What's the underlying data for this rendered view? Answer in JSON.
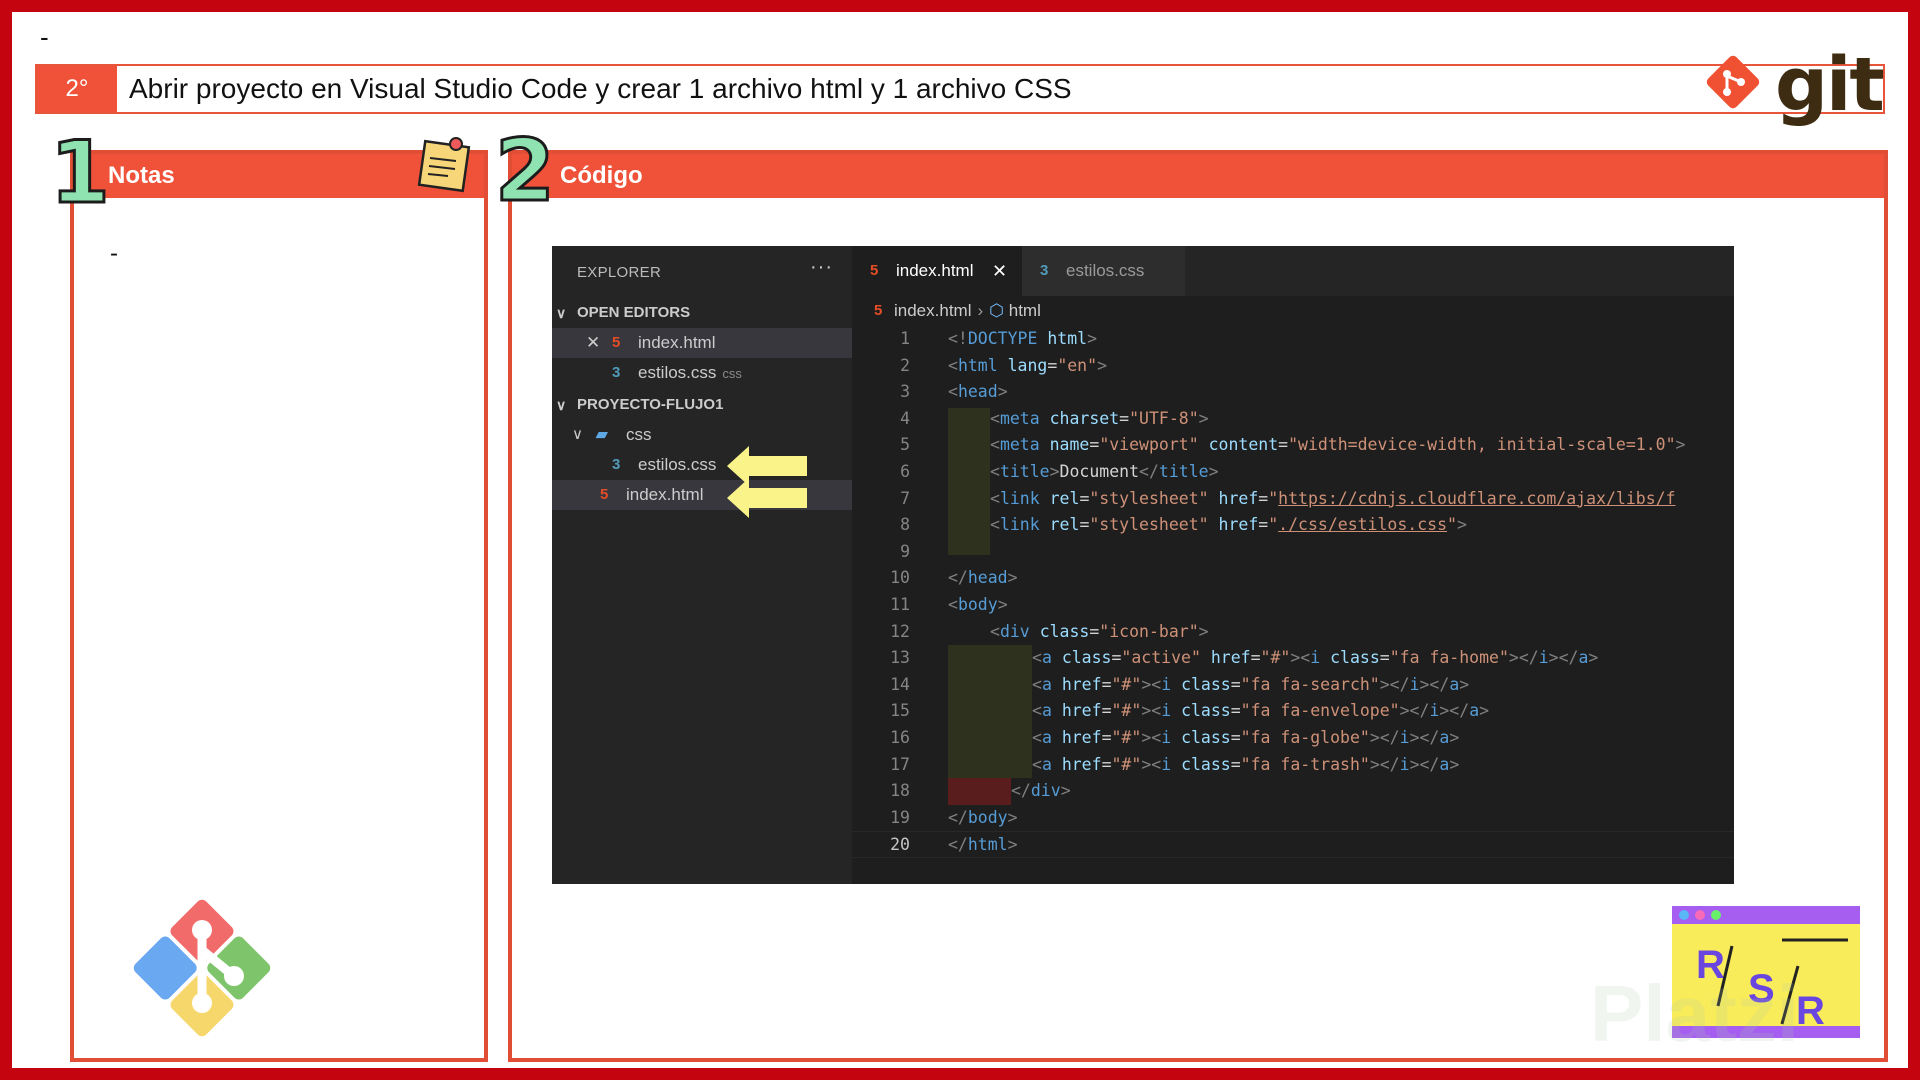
{
  "slide": {
    "top_dash": "-",
    "step": "2°",
    "title": "Abrir proyecto en Visual Studio Code y crear 1 archivo html y 1 archivo CSS",
    "git_logo_text": "git",
    "notes_number": "1",
    "notes_title": "Notas",
    "notes_content": "-",
    "code_number": "2",
    "code_title": "Código",
    "rsr_logo_text": "R/S/R",
    "watermark": "Platzi"
  },
  "vscode": {
    "explorer_title": "EXPLORER",
    "more_icon": "···",
    "open_editors": {
      "label": "OPEN EDITORS",
      "items": [
        {
          "name": "index.html",
          "icon": "html5-icon",
          "extra": ""
        },
        {
          "name": "estilos.css",
          "icon": "css3-icon",
          "extra": "css"
        }
      ]
    },
    "project": {
      "label": "PROYECTO-FLUJO1",
      "folder": "css",
      "files": [
        {
          "name": "estilos.css",
          "icon": "css3-icon"
        },
        {
          "name": "index.html",
          "icon": "html5-icon"
        }
      ]
    },
    "tabs": [
      {
        "label": "index.html",
        "active": true
      },
      {
        "label": "estilos.css",
        "active": false
      }
    ],
    "breadcrumb": {
      "file": "index.html",
      "node": "html"
    },
    "current_line": 20,
    "code_lines": [
      {
        "n": "1",
        "tokens": [
          [
            "b",
            "<!"
          ],
          [
            "t",
            "DOCTYPE"
          ],
          [
            "x",
            " "
          ],
          [
            "a",
            "html"
          ],
          [
            "b",
            ">"
          ]
        ]
      },
      {
        "n": "2",
        "tokens": [
          [
            "b",
            "<"
          ],
          [
            "t",
            "html"
          ],
          [
            "x",
            " "
          ],
          [
            "a",
            "lang"
          ],
          [
            "x",
            "="
          ],
          [
            "s",
            "\"en\""
          ],
          [
            "b",
            ">"
          ]
        ]
      },
      {
        "n": "3",
        "tokens": [
          [
            "b",
            "<"
          ],
          [
            "t",
            "head"
          ],
          [
            "b",
            ">"
          ]
        ]
      },
      {
        "n": "4",
        "indent": 1,
        "tokens": [
          [
            "b",
            "<"
          ],
          [
            "t",
            "meta"
          ],
          [
            "x",
            " "
          ],
          [
            "a",
            "charset"
          ],
          [
            "x",
            "="
          ],
          [
            "s",
            "\"UTF-8\""
          ],
          [
            "b",
            ">"
          ]
        ]
      },
      {
        "n": "5",
        "indent": 1,
        "tokens": [
          [
            "b",
            "<"
          ],
          [
            "t",
            "meta"
          ],
          [
            "x",
            " "
          ],
          [
            "a",
            "name"
          ],
          [
            "x",
            "="
          ],
          [
            "s",
            "\"viewport\""
          ],
          [
            "x",
            " "
          ],
          [
            "a",
            "content"
          ],
          [
            "x",
            "="
          ],
          [
            "s",
            "\"width=device-width, initial-scale=1.0\""
          ],
          [
            "b",
            ">"
          ]
        ]
      },
      {
        "n": "6",
        "indent": 1,
        "tokens": [
          [
            "b",
            "<"
          ],
          [
            "t",
            "title"
          ],
          [
            "b",
            ">"
          ],
          [
            "x",
            "Document"
          ],
          [
            "b",
            "</"
          ],
          [
            "t",
            "title"
          ],
          [
            "b",
            ">"
          ]
        ]
      },
      {
        "n": "7",
        "indent": 1,
        "tokens": [
          [
            "b",
            "<"
          ],
          [
            "t",
            "link"
          ],
          [
            "x",
            " "
          ],
          [
            "a",
            "rel"
          ],
          [
            "x",
            "="
          ],
          [
            "s",
            "\"stylesheet\""
          ],
          [
            "x",
            " "
          ],
          [
            "a",
            "href"
          ],
          [
            "x",
            "="
          ],
          [
            "s",
            "\""
          ],
          [
            "l",
            "https://cdnjs.cloudflare.com/ajax/libs/f"
          ]
        ]
      },
      {
        "n": "8",
        "indent": 1,
        "tokens": [
          [
            "b",
            "<"
          ],
          [
            "t",
            "link"
          ],
          [
            "x",
            " "
          ],
          [
            "a",
            "rel"
          ],
          [
            "x",
            "="
          ],
          [
            "s",
            "\"stylesheet\""
          ],
          [
            "x",
            " "
          ],
          [
            "a",
            "href"
          ],
          [
            "x",
            "="
          ],
          [
            "s",
            "\""
          ],
          [
            "l",
            "./css/estilos.css"
          ],
          [
            "s",
            "\""
          ],
          [
            "b",
            ">"
          ]
        ]
      },
      {
        "n": "9",
        "indent": 1,
        "tokens": []
      },
      {
        "n": "10",
        "tokens": [
          [
            "b",
            "</"
          ],
          [
            "t",
            "head"
          ],
          [
            "b",
            ">"
          ]
        ]
      },
      {
        "n": "11",
        "tokens": [
          [
            "b",
            "<"
          ],
          [
            "t",
            "body"
          ],
          [
            "b",
            ">"
          ]
        ]
      },
      {
        "n": "12",
        "indent": 1,
        "tokens": [
          [
            "b",
            "<"
          ],
          [
            "t",
            "div"
          ],
          [
            "x",
            " "
          ],
          [
            "a",
            "class"
          ],
          [
            "x",
            "="
          ],
          [
            "s",
            "\"icon-bar\""
          ],
          [
            "b",
            ">"
          ]
        ]
      },
      {
        "n": "13",
        "indent": 2,
        "tokens": [
          [
            "b",
            "<"
          ],
          [
            "t",
            "a"
          ],
          [
            "x",
            " "
          ],
          [
            "a",
            "class"
          ],
          [
            "x",
            "="
          ],
          [
            "s",
            "\"active\""
          ],
          [
            "x",
            " "
          ],
          [
            "a",
            "href"
          ],
          [
            "x",
            "="
          ],
          [
            "s",
            "\"#\""
          ],
          [
            "b",
            "><"
          ],
          [
            "t",
            "i"
          ],
          [
            "x",
            " "
          ],
          [
            "a",
            "class"
          ],
          [
            "x",
            "="
          ],
          [
            "s",
            "\"fa fa-home\""
          ],
          [
            "b",
            "></"
          ],
          [
            "t",
            "i"
          ],
          [
            "b",
            "></"
          ],
          [
            "t",
            "a"
          ],
          [
            "b",
            ">"
          ]
        ]
      },
      {
        "n": "14",
        "indent": 2,
        "tokens": [
          [
            "b",
            "<"
          ],
          [
            "t",
            "a"
          ],
          [
            "x",
            " "
          ],
          [
            "a",
            "href"
          ],
          [
            "x",
            "="
          ],
          [
            "s",
            "\"#\""
          ],
          [
            "b",
            "><"
          ],
          [
            "t",
            "i"
          ],
          [
            "x",
            " "
          ],
          [
            "a",
            "class"
          ],
          [
            "x",
            "="
          ],
          [
            "s",
            "\"fa fa-search\""
          ],
          [
            "b",
            "></"
          ],
          [
            "t",
            "i"
          ],
          [
            "b",
            "></"
          ],
          [
            "t",
            "a"
          ],
          [
            "b",
            ">"
          ]
        ]
      },
      {
        "n": "15",
        "indent": 2,
        "tokens": [
          [
            "b",
            "<"
          ],
          [
            "t",
            "a"
          ],
          [
            "x",
            " "
          ],
          [
            "a",
            "href"
          ],
          [
            "x",
            "="
          ],
          [
            "s",
            "\"#\""
          ],
          [
            "b",
            "><"
          ],
          [
            "t",
            "i"
          ],
          [
            "x",
            " "
          ],
          [
            "a",
            "class"
          ],
          [
            "x",
            "="
          ],
          [
            "s",
            "\"fa fa-envelope\""
          ],
          [
            "b",
            "></"
          ],
          [
            "t",
            "i"
          ],
          [
            "b",
            "></"
          ],
          [
            "t",
            "a"
          ],
          [
            "b",
            ">"
          ]
        ]
      },
      {
        "n": "16",
        "indent": 2,
        "tokens": [
          [
            "b",
            "<"
          ],
          [
            "t",
            "a"
          ],
          [
            "x",
            " "
          ],
          [
            "a",
            "href"
          ],
          [
            "x",
            "="
          ],
          [
            "s",
            "\"#\""
          ],
          [
            "b",
            "><"
          ],
          [
            "t",
            "i"
          ],
          [
            "x",
            " "
          ],
          [
            "a",
            "class"
          ],
          [
            "x",
            "="
          ],
          [
            "s",
            "\"fa fa-globe\""
          ],
          [
            "b",
            "></"
          ],
          [
            "t",
            "i"
          ],
          [
            "b",
            "></"
          ],
          [
            "t",
            "a"
          ],
          [
            "b",
            ">"
          ]
        ]
      },
      {
        "n": "17",
        "indent": 2,
        "tokens": [
          [
            "b",
            "<"
          ],
          [
            "t",
            "a"
          ],
          [
            "x",
            " "
          ],
          [
            "a",
            "href"
          ],
          [
            "x",
            "="
          ],
          [
            "s",
            "\"#\""
          ],
          [
            "b",
            "><"
          ],
          [
            "t",
            "i"
          ],
          [
            "x",
            " "
          ],
          [
            "a",
            "class"
          ],
          [
            "x",
            "="
          ],
          [
            "s",
            "\"fa fa-trash\""
          ],
          [
            "b",
            "></"
          ],
          [
            "t",
            "i"
          ],
          [
            "b",
            "></"
          ],
          [
            "t",
            "a"
          ],
          [
            "b",
            ">"
          ]
        ]
      },
      {
        "n": "18",
        "indent": 1.5,
        "tokens": [
          [
            "b",
            "</"
          ],
          [
            "t",
            "div"
          ],
          [
            "b",
            ">"
          ]
        ]
      },
      {
        "n": "19",
        "tokens": [
          [
            "b",
            "</"
          ],
          [
            "t",
            "body"
          ],
          [
            "b",
            ">"
          ]
        ]
      },
      {
        "n": "20",
        "tokens": [
          [
            "b",
            "</"
          ],
          [
            "t",
            "html"
          ],
          [
            "b",
            ">"
          ]
        ]
      }
    ]
  }
}
